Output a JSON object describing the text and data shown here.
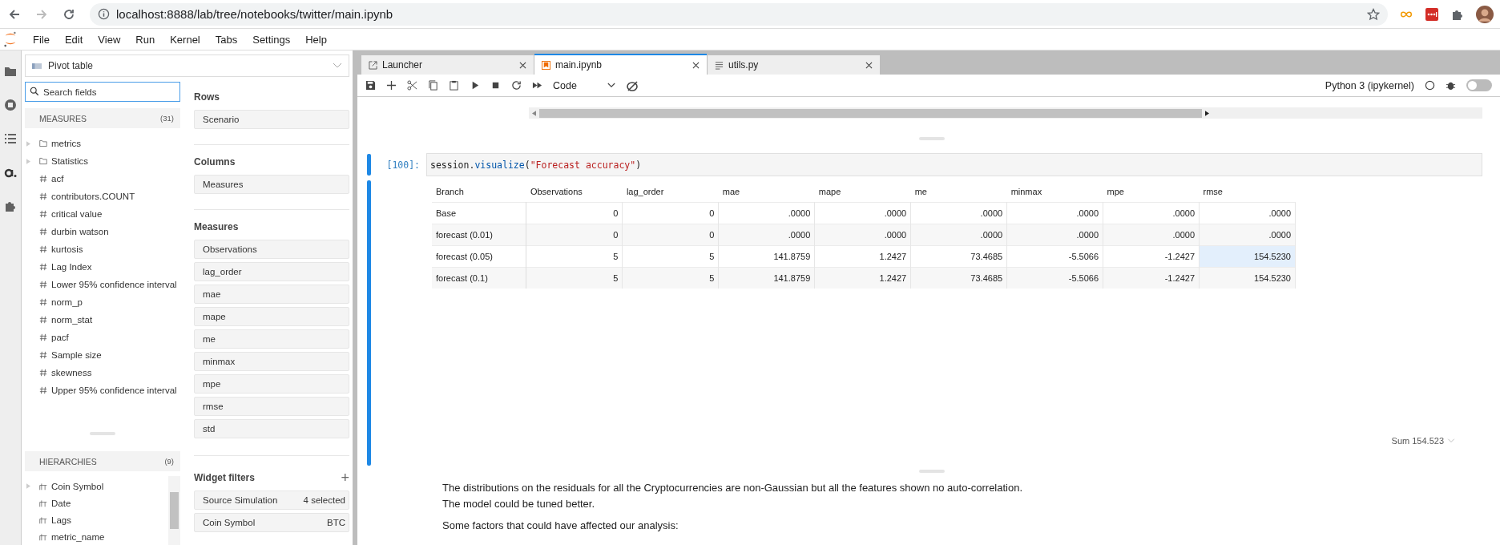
{
  "browser": {
    "url": "localhost:8888/lab/tree/notebooks/twitter/main.ipynb"
  },
  "menu": [
    "File",
    "Edit",
    "View",
    "Run",
    "Kernel",
    "Tabs",
    "Settings",
    "Help"
  ],
  "pivot": {
    "title": "Pivot table",
    "search": {
      "placeholder": "Search fields"
    },
    "measures": {
      "label": "MEASURES",
      "count": "(31)",
      "items": [
        {
          "kind": "folder",
          "name": "metrics"
        },
        {
          "kind": "folder",
          "name": "Statistics"
        },
        {
          "kind": "measure",
          "name": "acf"
        },
        {
          "kind": "measure",
          "name": "contributors.COUNT"
        },
        {
          "kind": "measure",
          "name": "critical value"
        },
        {
          "kind": "measure",
          "name": "durbin watson"
        },
        {
          "kind": "measure",
          "name": "kurtosis"
        },
        {
          "kind": "measure",
          "name": "Lag Index"
        },
        {
          "kind": "measure",
          "name": "Lower 95% confidence interval"
        },
        {
          "kind": "measure",
          "name": "norm_p"
        },
        {
          "kind": "measure",
          "name": "norm_stat"
        },
        {
          "kind": "measure",
          "name": "pacf"
        },
        {
          "kind": "measure",
          "name": "Sample size"
        },
        {
          "kind": "measure",
          "name": "skewness"
        },
        {
          "kind": "measure",
          "name": "Upper 95% confidence interval"
        }
      ]
    },
    "hierarchies": {
      "label": "HIERARCHIES",
      "count": "(9)",
      "items": [
        {
          "name": "Coin Symbol",
          "expandable": true
        },
        {
          "name": "Date",
          "expandable": false
        },
        {
          "name": "Lags",
          "expandable": false
        },
        {
          "name": "metric_name",
          "expandable": false
        }
      ]
    },
    "zones": [
      {
        "label": "Rows",
        "fields": [
          "Scenario"
        ]
      },
      {
        "label": "Columns",
        "fields": [
          "Measures"
        ]
      },
      {
        "label": "Measures",
        "fields": [
          "Observations",
          "lag_order",
          "mae",
          "mape",
          "me",
          "minmax",
          "mpe",
          "rmse",
          "std"
        ]
      }
    ],
    "widget_filters": {
      "label": "Widget filters",
      "add": "+",
      "items": [
        {
          "name": "Source Simulation",
          "value": "4 selected"
        },
        {
          "name": "Coin Symbol",
          "value": "BTC"
        }
      ]
    }
  },
  "notebook": {
    "tabs": [
      {
        "kind": "launcher",
        "label": "Launcher",
        "selected": false
      },
      {
        "kind": "notebook",
        "label": "main.ipynb",
        "selected": true
      },
      {
        "kind": "file",
        "label": "utils.py",
        "selected": false
      }
    ],
    "cell_type": "Code",
    "kernel": "Python 3 (ipykernel)",
    "debugger_on": false,
    "cell": {
      "prompt": "[100]:",
      "code": [
        {
          "kind": "plain",
          "text": "session."
        },
        {
          "kind": "function",
          "text": "visualize"
        },
        {
          "kind": "plain",
          "text": "("
        },
        {
          "kind": "string",
          "text": "\"Forecast accuracy\""
        },
        {
          "kind": "plain",
          "text": ")"
        }
      ]
    },
    "table": {
      "columns": [
        "Branch",
        "Observations",
        "lag_order",
        "mae",
        "mape",
        "me",
        "minmax",
        "mpe",
        "rmse"
      ],
      "rows": [
        {
          "cells": [
            {
              "text": "Base",
              "selected": false
            },
            {
              "text": "0",
              "selected": false
            },
            {
              "text": "0",
              "selected": false
            },
            {
              "text": ".0000",
              "selected": false
            },
            {
              "text": ".0000",
              "selected": false
            },
            {
              "text": ".0000",
              "selected": false
            },
            {
              "text": ".0000",
              "selected": false
            },
            {
              "text": ".0000",
              "selected": false
            },
            {
              "text": ".0000",
              "selected": false
            }
          ]
        },
        {
          "cells": [
            {
              "text": "forecast (0.01)",
              "selected": false
            },
            {
              "text": "0",
              "selected": false
            },
            {
              "text": "0",
              "selected": false
            },
            {
              "text": ".0000",
              "selected": false
            },
            {
              "text": ".0000",
              "selected": false
            },
            {
              "text": ".0000",
              "selected": false
            },
            {
              "text": ".0000",
              "selected": false
            },
            {
              "text": ".0000",
              "selected": false
            },
            {
              "text": ".0000",
              "selected": false
            }
          ]
        },
        {
          "cells": [
            {
              "text": "forecast (0.05)",
              "selected": false
            },
            {
              "text": "5",
              "selected": false
            },
            {
              "text": "5",
              "selected": false
            },
            {
              "text": "141.8759",
              "selected": false
            },
            {
              "text": "1.2427",
              "selected": false
            },
            {
              "text": "73.4685",
              "selected": false
            },
            {
              "text": "-5.5066",
              "selected": false
            },
            {
              "text": "-1.2427",
              "selected": false
            },
            {
              "text": "154.5230",
              "selected": true
            }
          ]
        },
        {
          "cells": [
            {
              "text": "forecast (0.1)",
              "selected": false
            },
            {
              "text": "5",
              "selected": false
            },
            {
              "text": "5",
              "selected": false
            },
            {
              "text": "141.8759",
              "selected": false
            },
            {
              "text": "1.2427",
              "selected": false
            },
            {
              "text": "73.4685",
              "selected": false
            },
            {
              "text": "-5.5066",
              "selected": false
            },
            {
              "text": "-1.2427",
              "selected": false
            },
            {
              "text": "154.5230",
              "selected": false
            }
          ]
        }
      ]
    },
    "sum": "Sum 154.523",
    "paragraphs": [
      [
        "The distributions on the residuals for all the Cryptocurrencies are non-Gaussian but all the features shown no auto-correlation.",
        "The model could be tuned better."
      ],
      [
        "Some factors that could have affected our analysis:"
      ]
    ]
  }
}
